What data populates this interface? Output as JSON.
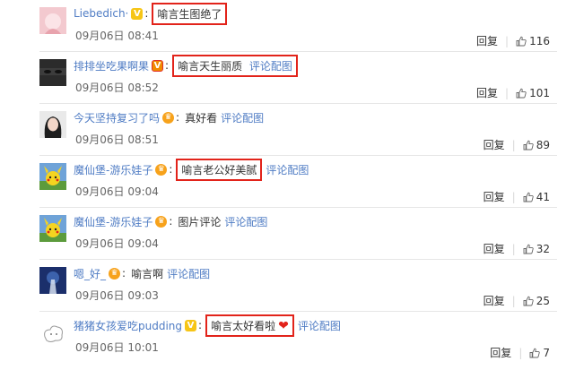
{
  "comments": [
    {
      "username": "Liebedich·",
      "badge": "V",
      "text": "喻言生图绝了",
      "link": "",
      "time": "09月06日 08:41",
      "reply_label": "回复",
      "likes": "116",
      "highlighted": true
    },
    {
      "username": "排排坐吃果啊果",
      "badge": "V",
      "text": "喻言天生丽质",
      "link": "评论配图",
      "time": "09月06日 08:52",
      "reply_label": "回复",
      "likes": "101",
      "highlighted": true
    },
    {
      "username": "今天坚持复习了吗",
      "badge": "crown",
      "text": "真好看",
      "link": "评论配图",
      "time": "09月06日 08:51",
      "reply_label": "回复",
      "likes": "89",
      "highlighted": false
    },
    {
      "username": "魔仙堡-游乐娃子",
      "badge": "crown",
      "text": "喻言老公好美腻",
      "link": "评论配图",
      "time": "09月06日 09:04",
      "reply_label": "回复",
      "likes": "41",
      "highlighted": true
    },
    {
      "username": "魔仙堡-游乐娃子",
      "badge": "crown",
      "text": "图片评论",
      "link": "评论配图",
      "time": "09月06日 09:04",
      "reply_label": "回复",
      "likes": "32",
      "highlighted": false
    },
    {
      "username": "嗯_好_",
      "badge": "crown",
      "text": "喻言啊",
      "link": "评论配图",
      "time": "09月06日 09:03",
      "reply_label": "回复",
      "likes": "25",
      "highlighted": false
    },
    {
      "username": "猪猪女孩爱吃pudding",
      "badge": "V",
      "text": "喻言太好看啦",
      "link": "评论配图",
      "time": "09月06日 10:01",
      "reply_label": "回复",
      "likes": "7",
      "highlighted": true,
      "heart": true
    }
  ]
}
